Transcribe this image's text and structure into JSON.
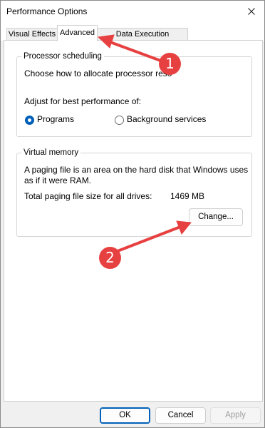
{
  "window": {
    "title": "Performance Options"
  },
  "tabs": [
    {
      "label": "Visual Effects"
    },
    {
      "label": "Advanced"
    },
    {
      "label": "Data Execution Prevention"
    }
  ],
  "processor_scheduling": {
    "title": "Processor scheduling",
    "description": "Choose how to allocate processor reso",
    "adjust_label": "Adjust for best performance of:",
    "options": [
      {
        "label": "Programs",
        "checked": true
      },
      {
        "label": "Background services",
        "checked": false
      }
    ]
  },
  "virtual_memory": {
    "title": "Virtual memory",
    "description_line1": "A paging file is an area on the hard disk that Windows uses",
    "description_line2": "as if it were RAM.",
    "total_label": "Total paging file size for all drives:",
    "total_value": "1469 MB",
    "change_button": "Change..."
  },
  "footer": {
    "ok": "OK",
    "cancel": "Cancel",
    "apply": "Apply"
  },
  "annotations": {
    "badge1": "1",
    "badge2": "2",
    "color": "#e74040"
  }
}
